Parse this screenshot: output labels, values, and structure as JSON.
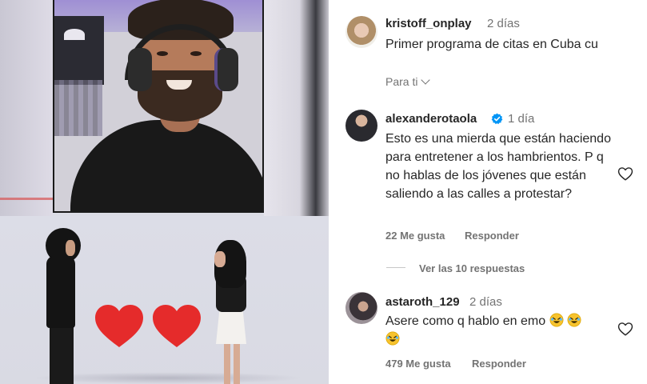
{
  "comments": [
    {
      "username": "kristoff_onplay",
      "time": "2 días",
      "text": "Primer programa de citas en Cuba cu",
      "translate_label": "Para ti"
    },
    {
      "username": "alexanderotaola",
      "verified": true,
      "time": "1 día",
      "text": "Esto es una mierda que están haciendo para entretener a los hambrientos. P q no hablas de los jóvenes que están saliendo a las calles a protestar?",
      "likes": "22 Me gusta",
      "reply_label": "Responder",
      "view_replies": "Ver las 10 respuestas"
    },
    {
      "username": "astaroth_129",
      "time": "2 días",
      "text": "Asere como q hablo en emo",
      "emojis": [
        "rolling-on-floor-laughing",
        "rolling-on-floor-laughing",
        "rolling-on-floor-laughing"
      ],
      "likes": "479 Me gusta",
      "reply_label": "Responder"
    }
  ],
  "colors": {
    "text_primary": "#262626",
    "text_secondary": "#737373",
    "verified_blue": "#0095f6",
    "heart_red": "#e52b2b"
  },
  "icons": [
    "verified-badge-icon",
    "heart-outline-icon",
    "chevron-down-icon",
    "heart-emoji"
  ]
}
